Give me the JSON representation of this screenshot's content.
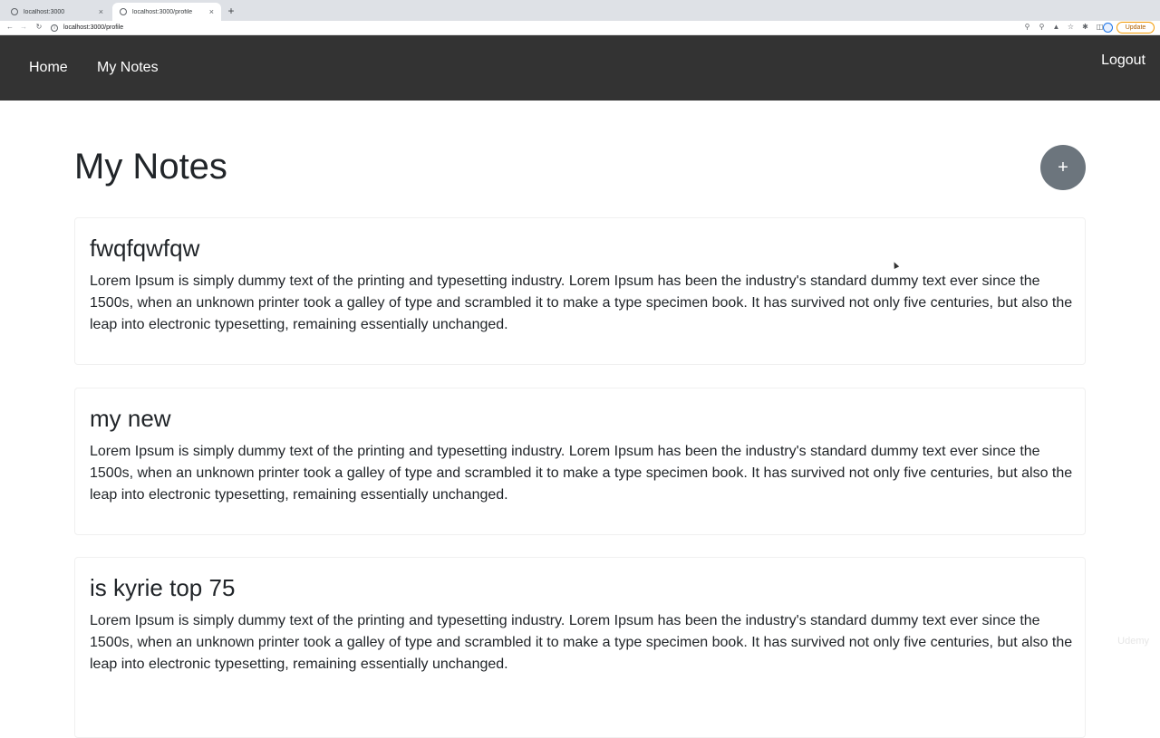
{
  "browser": {
    "tabs": [
      {
        "title": "localhost:3000",
        "close": "×",
        "active": false
      },
      {
        "title": "localhost:3000/profile",
        "close": "×",
        "active": true
      }
    ],
    "new_tab": "+",
    "url": "localhost:3000/profile",
    "update_label": "Update"
  },
  "navbar": {
    "links": [
      {
        "label": "Home"
      },
      {
        "label": "My Notes"
      }
    ],
    "logout_label": "Logout"
  },
  "main": {
    "title": "My Notes",
    "add_button_label": "+",
    "notes": [
      {
        "title": "fwqfqwfqw",
        "body": "Lorem Ipsum is simply dummy text of the printing and typesetting industry. Lorem Ipsum has been the industry's standard dummy text ever since the 1500s, when an unknown printer took a galley of type and scrambled it to make a type specimen book. It has survived not only five centuries, but also the leap into electronic typesetting, remaining essentially unchanged."
      },
      {
        "title": "my new",
        "body": "Lorem Ipsum is simply dummy text of the printing and typesetting industry. Lorem Ipsum has been the industry's standard dummy text ever since the 1500s, when an unknown printer took a galley of type and scrambled it to make a type specimen book. It has survived not only five centuries, but also the leap into electronic typesetting, remaining essentially unchanged."
      },
      {
        "title": "is kyrie top 75",
        "body": "Lorem Ipsum is simply dummy text of the printing and typesetting industry. Lorem Ipsum has been the industry's standard dummy text ever since the 1500s, when an unknown printer took a galley of type and scrambled it to make a type specimen book. It has survived not only five centuries, but also the leap into electronic typesetting, remaining essentially unchanged."
      }
    ]
  },
  "watermark": "Udemy",
  "colors": {
    "navbar_bg": "#333333",
    "add_button_bg": "#6c757d",
    "text": "#212529"
  }
}
